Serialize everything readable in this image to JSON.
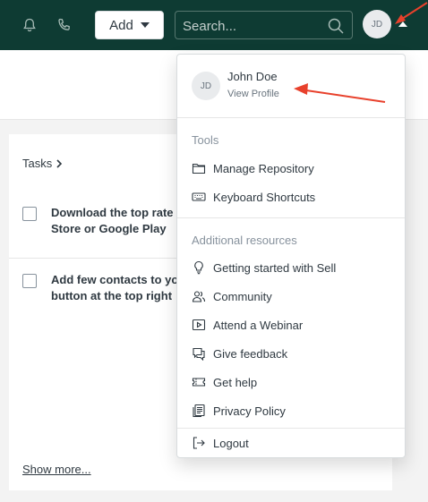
{
  "topbar": {
    "add_label": "Add",
    "search_placeholder": "Search...",
    "avatar_initials": "JD"
  },
  "tasks": {
    "title": "Tasks",
    "items": [
      {
        "line1": "Download the top rate",
        "line2": "Store or Google Play"
      },
      {
        "line1": "Add few contacts to yo",
        "line2": "button at the top right"
      }
    ],
    "show_more": "Show more..."
  },
  "profile_menu": {
    "avatar_initials": "JD",
    "user_name": "John Doe",
    "view_profile": "View Profile",
    "tools_heading": "Tools",
    "tools": [
      {
        "label": "Manage Repository",
        "icon": "folder-icon"
      },
      {
        "label": "Keyboard Shortcuts",
        "icon": "keyboard-icon"
      }
    ],
    "resources_heading": "Additional resources",
    "resources": [
      {
        "label": "Getting started with Sell",
        "icon": "lightbulb-icon"
      },
      {
        "label": "Community",
        "icon": "community-icon"
      },
      {
        "label": "Attend a Webinar",
        "icon": "webinar-icon"
      },
      {
        "label": "Give feedback",
        "icon": "feedback-icon"
      },
      {
        "label": "Get help",
        "icon": "ticket-icon"
      },
      {
        "label": "Privacy Policy",
        "icon": "document-icon"
      }
    ],
    "logout": "Logout"
  },
  "colors": {
    "topbar_bg": "#0e3b33",
    "annotation_arrow": "#e8412c"
  }
}
